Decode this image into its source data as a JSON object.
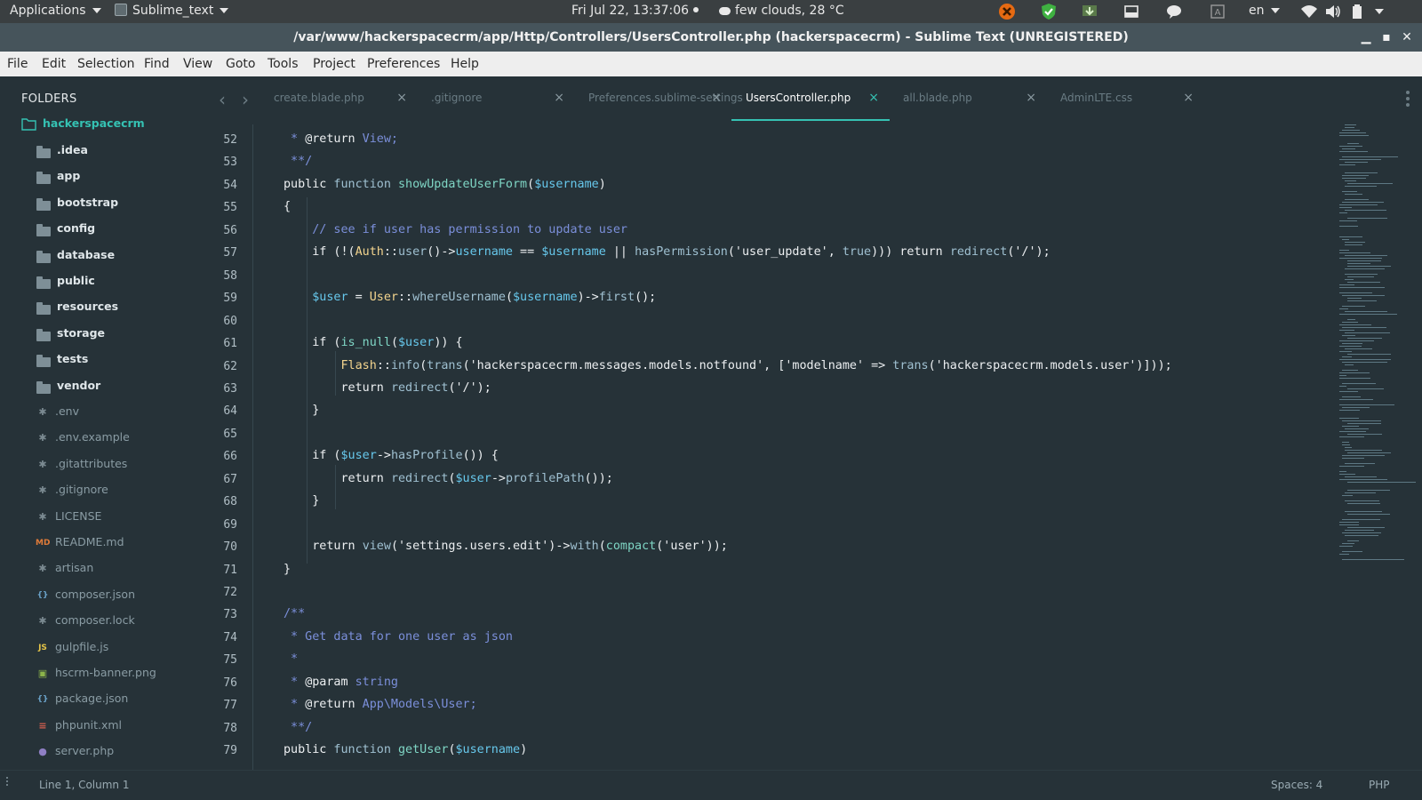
{
  "system_panel": {
    "applications": "Applications",
    "app_name": "Sublime_text",
    "clock": "Fri Jul 22, 13:37:06",
    "weather": "few clouds, 28 °C",
    "language": "en"
  },
  "window": {
    "title": "/var/www/hackerspacecrm/app/Http/Controllers/UsersController.php (hackerspacecrm) - Sublime Text (UNREGISTERED)"
  },
  "menu": [
    "File",
    "Edit",
    "Selection",
    "Find",
    "View",
    "Goto",
    "Tools",
    "Project",
    "Preferences",
    "Help"
  ],
  "sidebar": {
    "header": "FOLDERS",
    "root": "hackerspacecrm",
    "folders": [
      ".idea",
      "app",
      "bootstrap",
      "config",
      "database",
      "public",
      "resources",
      "storage",
      "tests",
      "vendor"
    ],
    "files": [
      {
        "name": ".env",
        "icon": "asterisk-icon"
      },
      {
        "name": ".env.example",
        "icon": "asterisk-icon"
      },
      {
        "name": ".gitattributes",
        "icon": "asterisk-icon"
      },
      {
        "name": ".gitignore",
        "icon": "asterisk-icon"
      },
      {
        "name": "LICENSE",
        "icon": "asterisk-icon"
      },
      {
        "name": "README.md",
        "icon": "markdown-icon"
      },
      {
        "name": "artisan",
        "icon": "asterisk-icon"
      },
      {
        "name": "composer.json",
        "icon": "braces-icon"
      },
      {
        "name": "composer.lock",
        "icon": "asterisk-icon"
      },
      {
        "name": "gulpfile.js",
        "icon": "javascript-icon"
      },
      {
        "name": "hscrm-banner.png",
        "icon": "image-icon"
      },
      {
        "name": "package.json",
        "icon": "braces-icon"
      },
      {
        "name": "phpunit.xml",
        "icon": "xml-icon"
      },
      {
        "name": "server.php",
        "icon": "php-icon"
      }
    ]
  },
  "tabs": [
    {
      "label": "create.blade.php",
      "active": false
    },
    {
      "label": ".gitignore",
      "active": false
    },
    {
      "label": "Preferences.sublime-settings",
      "active": false
    },
    {
      "label": "UsersController.php",
      "active": true
    },
    {
      "label": "all.blade.php",
      "active": false
    },
    {
      "label": "AdminLTE.css",
      "active": false
    }
  ],
  "editor": {
    "lines": [
      {
        "n": 52,
        "segs": [
          [
            " * ",
            "cmt"
          ],
          [
            "@return",
            "plain"
          ],
          [
            " View;",
            "cmt"
          ]
        ]
      },
      {
        "n": 53,
        "segs": [
          [
            " **/",
            "cmt"
          ]
        ]
      },
      {
        "n": 54,
        "segs": [
          [
            "public",
            "plain"
          ],
          [
            " function ",
            "kw"
          ],
          [
            "showUpdateUserForm",
            "fn"
          ],
          [
            "(",
            "plain"
          ],
          [
            "$username",
            "var"
          ],
          [
            ")",
            "plain"
          ]
        ]
      },
      {
        "n": 55,
        "segs": [
          [
            "{",
            "plain"
          ]
        ]
      },
      {
        "n": 56,
        "segs": [
          [
            "    // see if user has permission to update user",
            "cmt"
          ]
        ]
      },
      {
        "n": 57,
        "segs": [
          [
            "    if (!(",
            "plain"
          ],
          [
            "Auth",
            "cls"
          ],
          [
            "::",
            "plain"
          ],
          [
            "user",
            "kw"
          ],
          [
            "()->",
            "plain"
          ],
          [
            "username",
            "var"
          ],
          [
            " == ",
            "plain"
          ],
          [
            "$username",
            "var"
          ],
          [
            " || ",
            "plain"
          ],
          [
            "hasPermission",
            "kw"
          ],
          [
            "('user_update', ",
            "plain"
          ],
          [
            "true",
            "kw"
          ],
          [
            ")))",
            "plain"
          ],
          [
            " return ",
            "plain"
          ],
          [
            "redirect",
            "kw"
          ],
          [
            "('/');",
            "plain"
          ]
        ]
      },
      {
        "n": 58,
        "segs": []
      },
      {
        "n": 59,
        "segs": [
          [
            "    ",
            "plain"
          ],
          [
            "$user",
            "var"
          ],
          [
            " = ",
            "plain"
          ],
          [
            "User",
            "cls"
          ],
          [
            "::",
            "plain"
          ],
          [
            "whereUsername",
            "kw"
          ],
          [
            "(",
            "plain"
          ],
          [
            "$username",
            "var"
          ],
          [
            ")->",
            "plain"
          ],
          [
            "first",
            "kw"
          ],
          [
            "();",
            "plain"
          ]
        ]
      },
      {
        "n": 60,
        "segs": []
      },
      {
        "n": 61,
        "segs": [
          [
            "    if (",
            "plain"
          ],
          [
            "is_null",
            "fn"
          ],
          [
            "(",
            "plain"
          ],
          [
            "$user",
            "var"
          ],
          [
            ")) {",
            "plain"
          ]
        ]
      },
      {
        "n": 62,
        "segs": [
          [
            "        ",
            "plain"
          ],
          [
            "Flash",
            "cls"
          ],
          [
            "::",
            "plain"
          ],
          [
            "info",
            "kw"
          ],
          [
            "(",
            "plain"
          ],
          [
            "trans",
            "kw"
          ],
          [
            "('hackerspacecrm.messages.models.notfound', ['modelname' => ",
            "plain"
          ],
          [
            "trans",
            "kw"
          ],
          [
            "('hackerspacecrm.models.user')]));",
            "plain"
          ]
        ]
      },
      {
        "n": 63,
        "segs": [
          [
            "        return ",
            "plain"
          ],
          [
            "redirect",
            "kw"
          ],
          [
            "('/');",
            "plain"
          ]
        ]
      },
      {
        "n": 64,
        "segs": [
          [
            "    }",
            "plain"
          ]
        ]
      },
      {
        "n": 65,
        "segs": []
      },
      {
        "n": 66,
        "segs": [
          [
            "    if (",
            "plain"
          ],
          [
            "$user",
            "var"
          ],
          [
            "->",
            "plain"
          ],
          [
            "hasProfile",
            "kw"
          ],
          [
            "()) {",
            "plain"
          ]
        ]
      },
      {
        "n": 67,
        "segs": [
          [
            "        return ",
            "plain"
          ],
          [
            "redirect",
            "kw"
          ],
          [
            "(",
            "plain"
          ],
          [
            "$user",
            "var"
          ],
          [
            "->",
            "plain"
          ],
          [
            "profilePath",
            "kw"
          ],
          [
            "());",
            "plain"
          ]
        ]
      },
      {
        "n": 68,
        "segs": [
          [
            "    }",
            "plain"
          ]
        ]
      },
      {
        "n": 69,
        "segs": []
      },
      {
        "n": 70,
        "segs": [
          [
            "    return ",
            "plain"
          ],
          [
            "view",
            "kw"
          ],
          [
            "('settings.users.edit')->",
            "plain"
          ],
          [
            "with",
            "kw"
          ],
          [
            "(",
            "plain"
          ],
          [
            "compact",
            "fn"
          ],
          [
            "('user'));",
            "plain"
          ]
        ]
      },
      {
        "n": 71,
        "segs": [
          [
            "}",
            "plain"
          ]
        ]
      },
      {
        "n": 72,
        "segs": []
      },
      {
        "n": 73,
        "segs": [
          [
            "/**",
            "cmt"
          ]
        ]
      },
      {
        "n": 74,
        "segs": [
          [
            " * Get data for one user as json",
            "cmt"
          ]
        ]
      },
      {
        "n": 75,
        "segs": [
          [
            " *",
            "cmt"
          ]
        ]
      },
      {
        "n": 76,
        "segs": [
          [
            " * ",
            "cmt"
          ],
          [
            "@param",
            "plain"
          ],
          [
            " string",
            "cmt"
          ]
        ]
      },
      {
        "n": 77,
        "segs": [
          [
            " * ",
            "cmt"
          ],
          [
            "@return",
            "plain"
          ],
          [
            " App\\Models\\User;",
            "cmt"
          ]
        ]
      },
      {
        "n": 78,
        "segs": [
          [
            " **/",
            "cmt"
          ]
        ]
      },
      {
        "n": 79,
        "segs": [
          [
            "public",
            "plain"
          ],
          [
            " function ",
            "kw"
          ],
          [
            "getUser",
            "fn"
          ],
          [
            "(",
            "plain"
          ],
          [
            "$username",
            "var"
          ],
          [
            ")",
            "plain"
          ]
        ]
      }
    ]
  },
  "status_bar": {
    "position": "Line 1, Column 1",
    "indentation": "Spaces: 4",
    "syntax": "PHP"
  },
  "colors": {
    "background": "#263238",
    "accent": "#35c2b3",
    "menu_bg": "#eeeeee",
    "title_bg": "#46545b"
  }
}
